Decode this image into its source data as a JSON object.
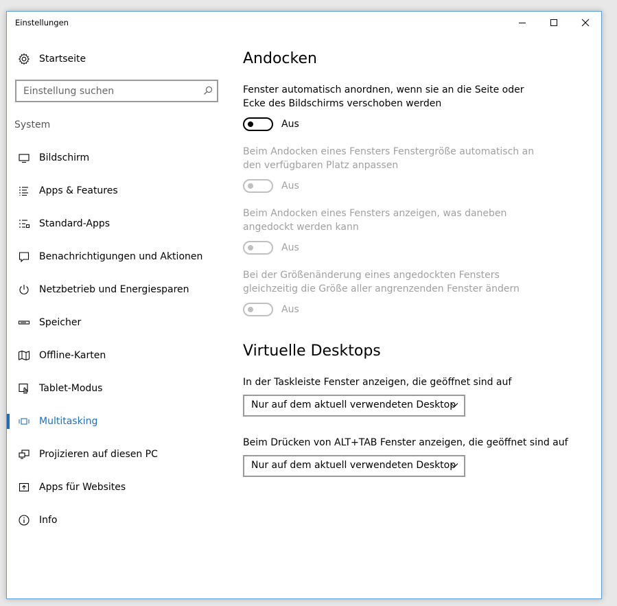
{
  "window": {
    "title": "Einstellungen",
    "accent_color": "#1f6fb8"
  },
  "sidebar": {
    "home_label": "Startseite",
    "search_placeholder": "Einstellung suchen",
    "section_label": "System",
    "items": [
      {
        "label": "Bildschirm",
        "icon": "monitor-icon"
      },
      {
        "label": "Apps & Features",
        "icon": "list-icon"
      },
      {
        "label": "Standard-Apps",
        "icon": "default-apps-icon"
      },
      {
        "label": "Benachrichtigungen und Aktionen",
        "icon": "notification-icon"
      },
      {
        "label": "Netzbetrieb und Energiesparen",
        "icon": "power-icon"
      },
      {
        "label": "Speicher",
        "icon": "storage-icon"
      },
      {
        "label": "Offline-Karten",
        "icon": "map-icon"
      },
      {
        "label": "Tablet-Modus",
        "icon": "tablet-icon"
      },
      {
        "label": "Multitasking",
        "icon": "multitasking-icon",
        "active": true
      },
      {
        "label": "Projizieren auf diesen PC",
        "icon": "project-icon"
      },
      {
        "label": "Apps für Websites",
        "icon": "web-apps-icon"
      },
      {
        "label": "Info",
        "icon": "info-icon"
      }
    ]
  },
  "main": {
    "snap": {
      "heading": "Andocken",
      "settings": [
        {
          "description": "Fenster automatisch anordnen, wenn sie an die Seite oder Ecke des Bildschirms verschoben werden",
          "state": "Aus",
          "enabled": true
        },
        {
          "description": "Beim Andocken eines Fensters Fenstergröße automatisch an den verfügbaren Platz anpassen",
          "state": "Aus",
          "enabled": false
        },
        {
          "description": "Beim Andocken eines Fensters anzeigen, was daneben angedockt werden kann",
          "state": "Aus",
          "enabled": false
        },
        {
          "description": "Bei der Größenänderung eines angedockten Fensters gleichzeitig die Größe aller angrenzenden Fenster ändern",
          "state": "Aus",
          "enabled": false
        }
      ]
    },
    "virtual_desktops": {
      "heading": "Virtuelle Desktops",
      "taskbar_label": "In der Taskleiste Fenster anzeigen, die geöffnet sind auf",
      "taskbar_value": "Nur auf dem aktuell verwendeten Desktop",
      "alttab_label": "Beim Drücken von ALT+TAB Fenster anzeigen, die geöffnet sind auf",
      "alttab_value": "Nur auf dem aktuell verwendeten Desktop"
    }
  }
}
